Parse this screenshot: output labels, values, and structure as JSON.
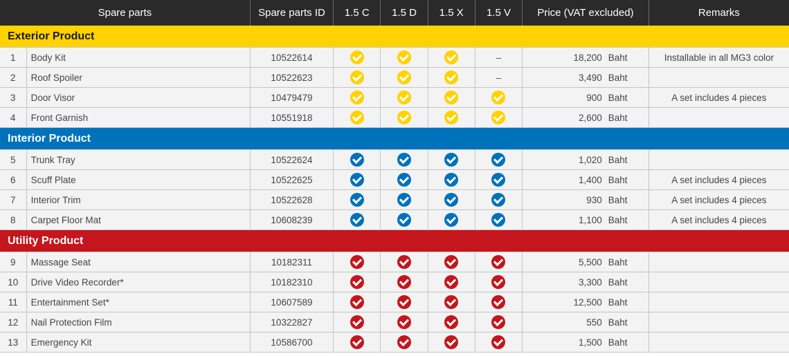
{
  "header": {
    "spare_parts": "Spare parts",
    "spare_parts_id": "Spare parts ID",
    "v15c": "1.5 C",
    "v15d": "1.5 D",
    "v15x": "1.5 X",
    "v15v": "1.5 V",
    "price": "Price (VAT excluded)",
    "remarks": "Remarks"
  },
  "colors": {
    "exterior": "#ffd200",
    "interior": "#0072bc",
    "utility": "#c4161c"
  },
  "sections": [
    {
      "key": "exterior",
      "title": "Exterior Product",
      "rows": [
        {
          "no": "1",
          "name": "Body Kit",
          "id": "10522614",
          "variants": [
            true,
            true,
            true,
            false
          ],
          "price": "18,200",
          "unit": "Baht",
          "remark": "Installable in all MG3 color"
        },
        {
          "no": "2",
          "name": "Roof Spoiler",
          "id": "10522623",
          "variants": [
            true,
            true,
            true,
            false
          ],
          "price": "3,490",
          "unit": "Baht",
          "remark": ""
        },
        {
          "no": "3",
          "name": "Door Visor",
          "id": "10479479",
          "variants": [
            true,
            true,
            true,
            true
          ],
          "price": "900",
          "unit": "Baht",
          "remark": "A set includes 4 pieces"
        },
        {
          "no": "4",
          "name": "Front Garnish",
          "id": "10551918",
          "variants": [
            true,
            true,
            true,
            true
          ],
          "price": "2,600",
          "unit": "Baht",
          "remark": ""
        }
      ]
    },
    {
      "key": "interior",
      "title": "Interior Product",
      "rows": [
        {
          "no": "5",
          "name": "Trunk Tray",
          "id": "10522624",
          "variants": [
            true,
            true,
            true,
            true
          ],
          "price": "1,020",
          "unit": "Baht",
          "remark": ""
        },
        {
          "no": "6",
          "name": "Scuff Plate",
          "id": "10522625",
          "variants": [
            true,
            true,
            true,
            true
          ],
          "price": "1,400",
          "unit": "Baht",
          "remark": "A set includes 4 pieces"
        },
        {
          "no": "7",
          "name": "Interior Trim",
          "id": "10522628",
          "variants": [
            true,
            true,
            true,
            true
          ],
          "price": "930",
          "unit": "Baht",
          "remark": "A set includes 4 pieces"
        },
        {
          "no": "8",
          "name": "Carpet Floor Mat",
          "id": "10608239",
          "variants": [
            true,
            true,
            true,
            true
          ],
          "price": "1,100",
          "unit": "Baht",
          "remark": "A set includes 4 pieces"
        }
      ]
    },
    {
      "key": "utility",
      "title": "Utility Product",
      "rows": [
        {
          "no": "9",
          "name": "Massage Seat",
          "id": "10182311",
          "variants": [
            true,
            true,
            true,
            true
          ],
          "price": "5,500",
          "unit": "Baht",
          "remark": ""
        },
        {
          "no": "10",
          "name": "Drive Video Recorder*",
          "id": "10182310",
          "variants": [
            true,
            true,
            true,
            true
          ],
          "price": "3,300",
          "unit": "Baht",
          "remark": ""
        },
        {
          "no": "11",
          "name": "Entertainment Set*",
          "id": "10607589",
          "variants": [
            true,
            true,
            true,
            true
          ],
          "price": "12,500",
          "unit": "Baht",
          "remark": ""
        },
        {
          "no": "12",
          "name": "Nail Protection Film",
          "id": "10322827",
          "variants": [
            true,
            true,
            true,
            true
          ],
          "price": "550",
          "unit": "Baht",
          "remark": ""
        },
        {
          "no": "13",
          "name": "Emergency Kit",
          "id": "10586700",
          "variants": [
            true,
            true,
            true,
            true
          ],
          "price": "1,500",
          "unit": "Baht",
          "remark": ""
        }
      ]
    }
  ],
  "unavailable_mark": "–"
}
